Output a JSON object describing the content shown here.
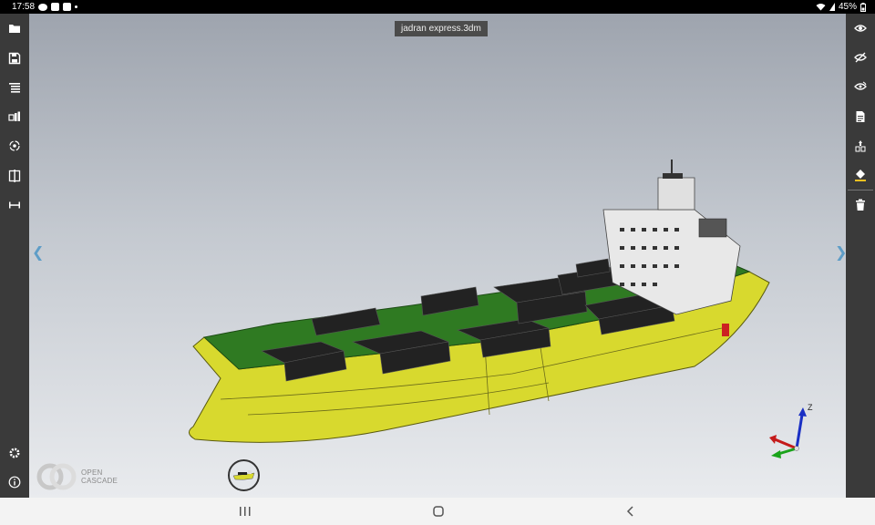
{
  "status_bar": {
    "time": "17:58",
    "battery": "45%",
    "icons": [
      "notification-icon",
      "image-icon",
      "facebook-icon",
      "dot-icon",
      "wifi-icon",
      "signal-icon",
      "battery-icon"
    ]
  },
  "viewer": {
    "file_name": "jadran express.3dm",
    "left_arrow": "❮",
    "right_arrow": "❯",
    "logo_line1": "OPEN",
    "logo_line2": "CASCADE",
    "triad_z": "Z"
  },
  "left_toolbar": [
    "folder-icon",
    "save-icon",
    "layers-icon",
    "objects-icon",
    "view-rotate-icon",
    "clip-plane-icon",
    "measure-icon",
    "settings-icon",
    "info-icon"
  ],
  "right_toolbar": [
    "show-icon",
    "hide-icon",
    "isolate-icon",
    "document-icon",
    "explode-icon",
    "fill-color-icon",
    "delete-icon"
  ],
  "colors": {
    "toolbar_bg": "#3a3a3a",
    "hull_yellow": "#d8d92e",
    "deck_green": "#2f7a22",
    "container_black": "#222222",
    "superstructure_white": "#e8e8e8",
    "accent_blue": "#5e9dc7"
  }
}
